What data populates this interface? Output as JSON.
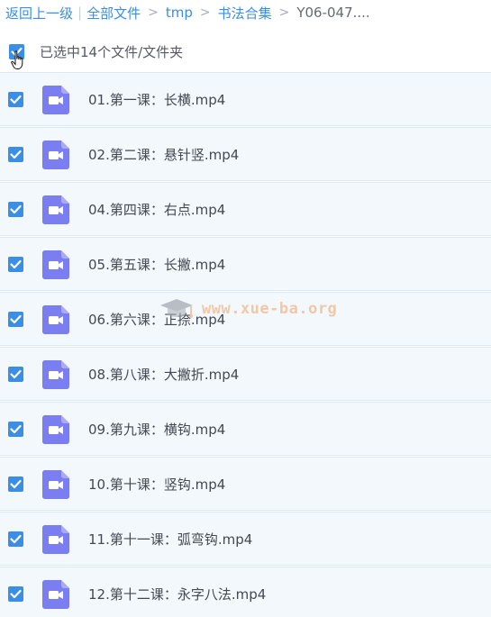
{
  "breadcrumb": {
    "back": "返回上一级",
    "separator_bar": "|",
    "items": [
      "全部文件",
      "tmp",
      "书法合集"
    ],
    "separator": ">",
    "current": "Y06-047...."
  },
  "selection": {
    "label": "已选中14个文件/文件夹",
    "checked": true
  },
  "files": [
    {
      "name": "01.第一课：长横.mp4",
      "checked": true,
      "icon": "video-file-icon"
    },
    {
      "name": "02.第二课：悬针竖.mp4",
      "checked": true,
      "icon": "video-file-icon"
    },
    {
      "name": "04.第四课：右点.mp4",
      "checked": true,
      "icon": "video-file-icon"
    },
    {
      "name": "05.第五课：长撇.mp4",
      "checked": true,
      "icon": "video-file-icon"
    },
    {
      "name": "06.第六课：正捺.mp4",
      "checked": true,
      "icon": "video-file-icon"
    },
    {
      "name": "08.第八课：大撇折.mp4",
      "checked": true,
      "icon": "video-file-icon"
    },
    {
      "name": "09.第九课：横钩.mp4",
      "checked": true,
      "icon": "video-file-icon"
    },
    {
      "name": "10.第十课：竖钩.mp4",
      "checked": true,
      "icon": "video-file-icon"
    },
    {
      "name": "11.第十一课：弧弯钩.mp4",
      "checked": true,
      "icon": "video-file-icon"
    },
    {
      "name": "12.第十二课：永字八法.mp4",
      "checked": true,
      "icon": "video-file-icon"
    }
  ],
  "watermark": {
    "text": "www.xue-ba.org"
  },
  "colors": {
    "accent": "#3a8ee6",
    "row_bg": "#f3f8fd",
    "video_icon": "#7b7ef0",
    "watermark": "#f0a060"
  }
}
